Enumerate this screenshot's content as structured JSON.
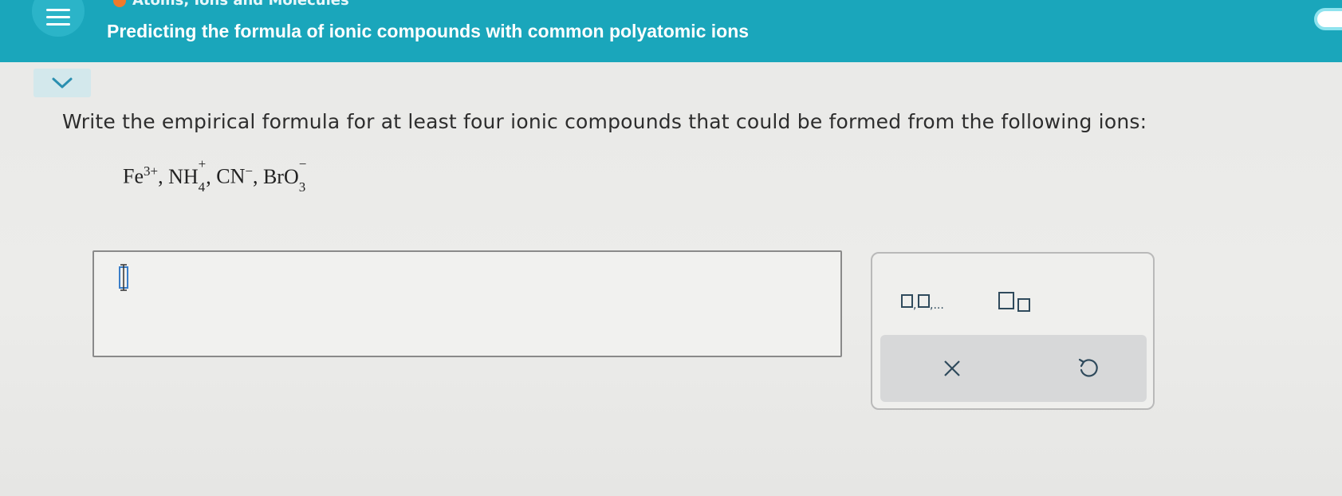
{
  "header": {
    "breadcrumb": "Atoms, Ions and Molecules",
    "title": "Predicting the formula of ionic compounds with common polyatomic ions",
    "colors": {
      "bar": "#1aa6bb",
      "breadcrumb_dot": "#f07a2a"
    }
  },
  "icons": {
    "menu": "hamburger-icon",
    "collapse": "chevron-down-icon",
    "cursor": "text-cursor-icon",
    "list": "comma-list-icon",
    "subscript": "subscript-icon",
    "clear": "close-icon",
    "undo": "undo-icon"
  },
  "question": {
    "instruction": "Write the empirical formula for at least four ionic compounds that could be formed from the following ions:",
    "ions": [
      {
        "base": "Fe",
        "charge": "3+",
        "subscript": "",
        "sep": ","
      },
      {
        "base": "NH",
        "charge": "+",
        "subscript": "4",
        "sep": ","
      },
      {
        "base": "CN",
        "charge": "−",
        "subscript": "",
        "sep": ","
      },
      {
        "base": "BrO",
        "charge": "−",
        "subscript": "3",
        "sep": ""
      }
    ]
  },
  "answer": {
    "value": ""
  },
  "palette": {
    "list_glyph": "□,□,...",
    "subscript_glyph": "□□",
    "clear_glyph": "×",
    "undo_glyph": "↺"
  }
}
